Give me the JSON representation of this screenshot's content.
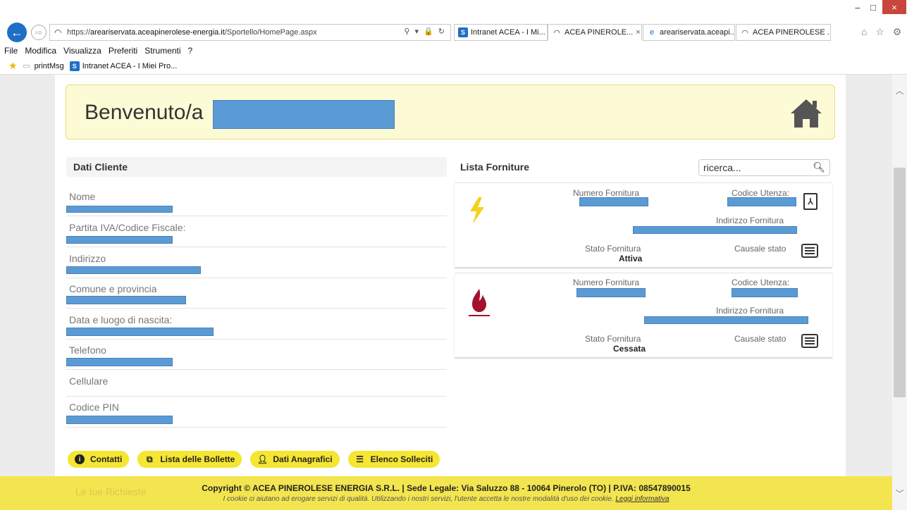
{
  "window": {
    "min_glyph": "–",
    "max_glyph": "□",
    "close_glyph": "×"
  },
  "browser": {
    "url_prefix": "https://",
    "url_host": "areariservata.aceapinerolese-energia.it",
    "url_path": "/Sportello/HomePage.aspx",
    "addr_tools": "⚲ ▾ 🔒 ↻",
    "tabs": [
      {
        "label": "Intranet ACEA - I Mi...",
        "icon": "sharepoint-icon",
        "glyph": "S"
      },
      {
        "label": "ACEA PINEROLE...",
        "icon": "acea-logo-icon",
        "glyph": "◠",
        "close": "×"
      },
      {
        "label": "areariservata.aceapi...",
        "icon": "ie-page-icon",
        "glyph": "e"
      },
      {
        "label": "ACEA PINEROLESE ...",
        "icon": "acea-logo-icon",
        "glyph": "◠"
      }
    ],
    "nav_icons": "⌂ ☆ ⚙",
    "menu": [
      "File",
      "Modifica",
      "Visualizza",
      "Preferiti",
      "Strumenti",
      "?"
    ],
    "favorites": [
      {
        "label": "printMsg",
        "icon": "page-icon"
      },
      {
        "label": "Intranet ACEA - I Miei Pro...",
        "icon": "sharepoint-icon"
      }
    ]
  },
  "page": {
    "welcome": "Benvenuto/a",
    "dati_cliente": {
      "title": "Dati Cliente",
      "fields": [
        "Nome",
        "Partita IVA/Codice Fiscale:",
        "Indirizzo",
        "Comune e provincia",
        "Data e luogo di nascita:",
        "Telefono",
        "Cellulare",
        "Codice PIN"
      ]
    },
    "forniture": {
      "title": "Lista Forniture",
      "search_placeholder": "ricerca...",
      "labels": {
        "numero": "Numero Fornitura",
        "codice": "Codice Utenza:",
        "indirizzo": "Indirizzo Fornitura",
        "stato": "Stato Fornitura",
        "causale": "Causale stato"
      },
      "items": [
        {
          "type": "electricity",
          "stato": "Attiva"
        },
        {
          "type": "gas",
          "stato": "Cessata"
        }
      ]
    },
    "buttons": [
      "Contatti",
      "Lista delle Bollette",
      "Dati Anagrafici",
      "Elenco Solleciti"
    ],
    "footer": {
      "richieste": "Le tue Richieste",
      "copyright": "Copyright © ACEA PINEROLESE ENERGIA S.R.L.  | Sede Legale: Via Saluzzo 88 - 10064 Pinerolo (TO) | P.IVA: 08547890015",
      "cookie": "I cookie ci aiutano ad erogare servizi di qualità. Utilizzando i nostri servizi, l'utente accetta le nostre modalità d'uso dei cookie.",
      "cookie_link": "Leggi informativa"
    },
    "colors": {
      "accent_yellow": "#f4e632",
      "redaction_blue": "#5b9bd5",
      "gas_red": "#a3122b",
      "bolt_yellow": "#f2d21b"
    }
  }
}
